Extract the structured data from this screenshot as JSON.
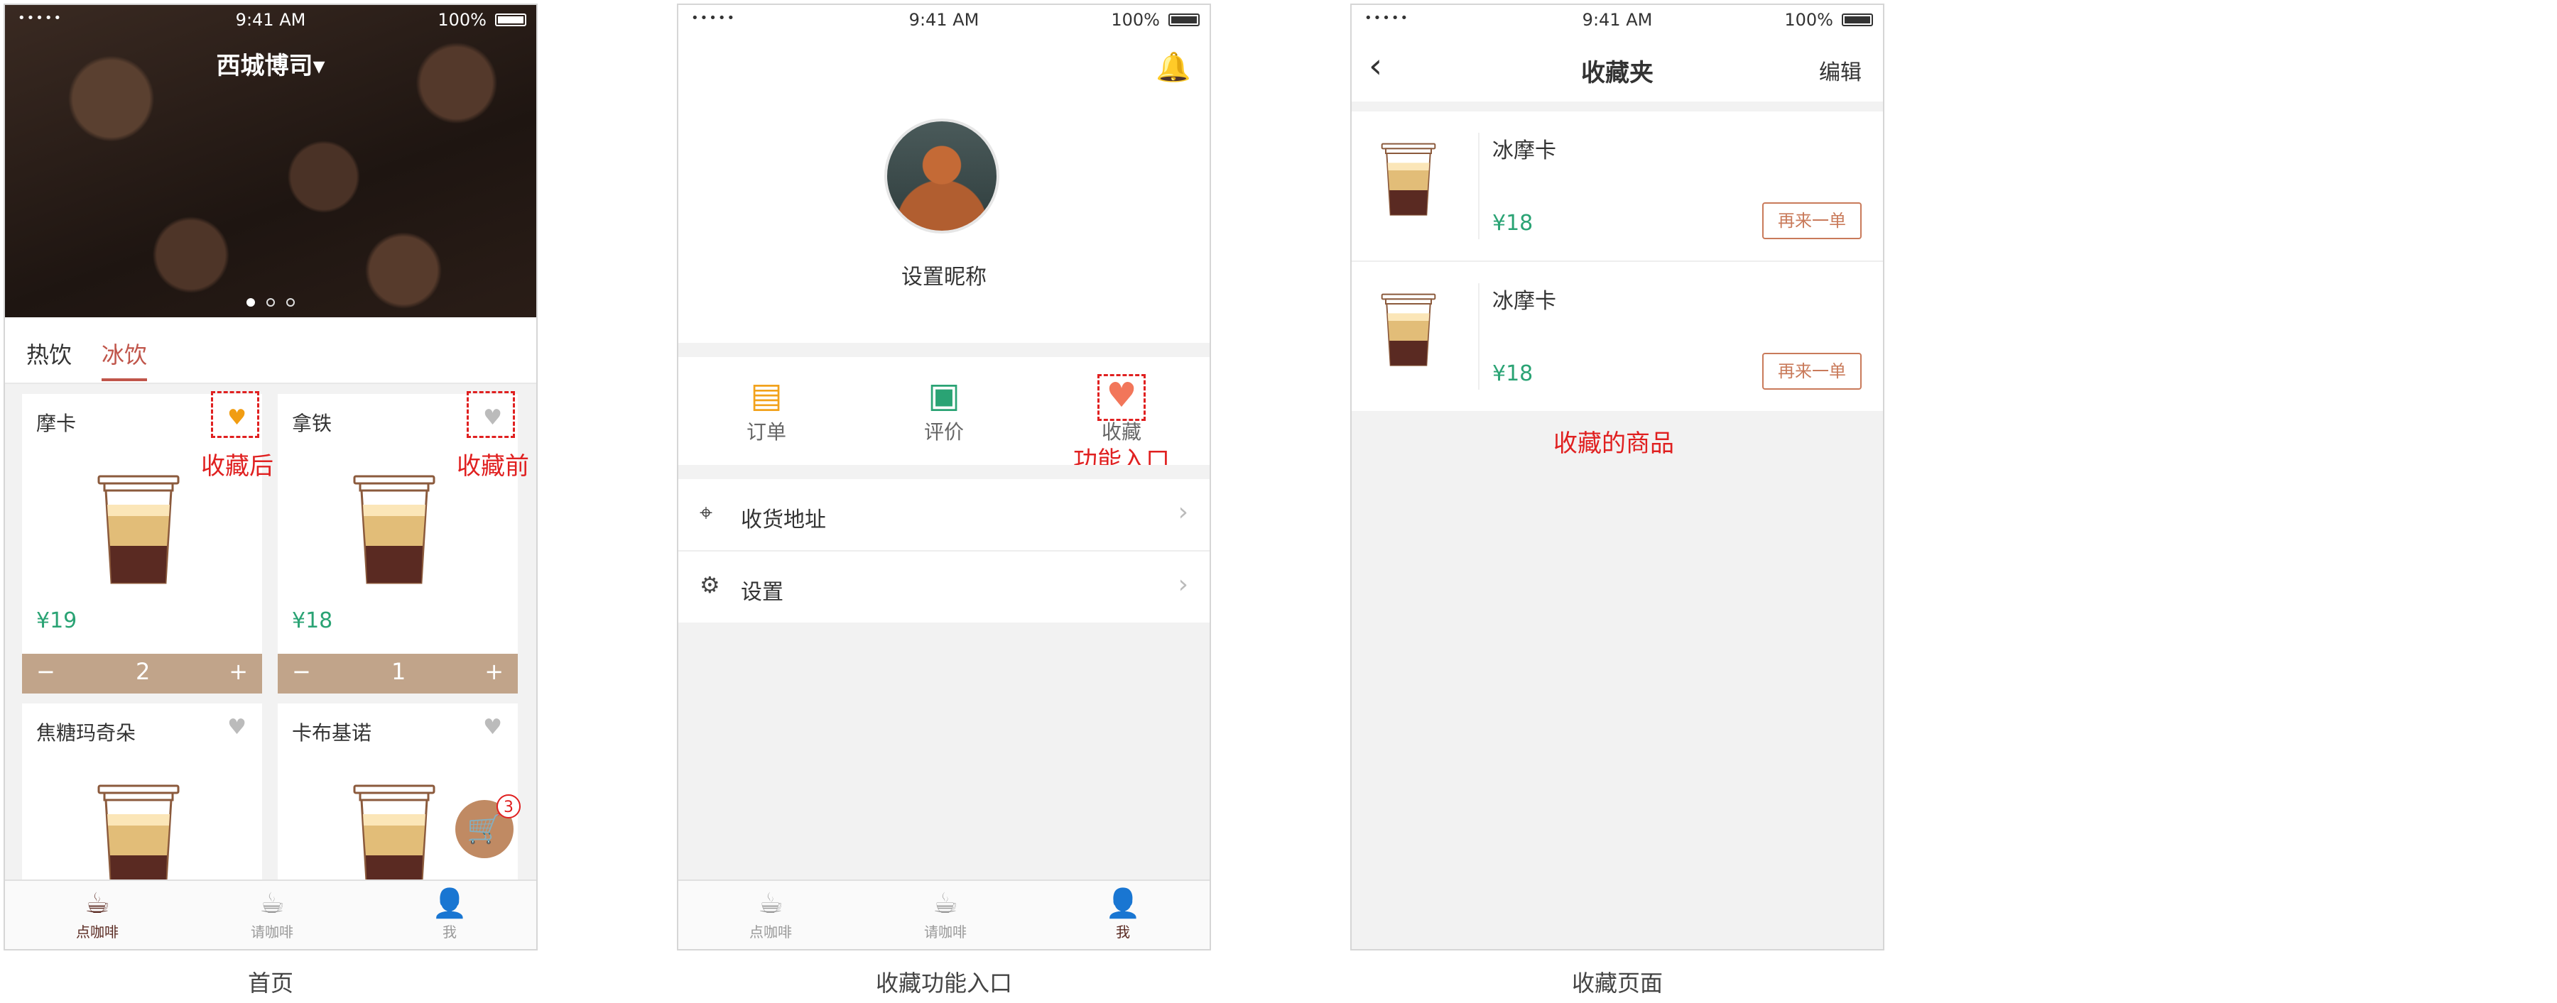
{
  "statusbar": {
    "time": "9:41 AM",
    "battery": "100%",
    "signal": "•••••"
  },
  "home": {
    "store_name": "西城博司▾",
    "tabs": [
      "热饮",
      "冰饮"
    ],
    "active_tab": "冰饮",
    "products": [
      {
        "name": "摩卡",
        "price": "¥19",
        "quantity": "2",
        "favorited": true
      },
      {
        "name": "拿铁",
        "price": "¥18",
        "quantity": "1",
        "favorited": false
      },
      {
        "name": "焦糖玛奇朵",
        "favorited": false
      },
      {
        "name": "卡布基诺",
        "favorited": false
      }
    ],
    "stepper_minus": "−",
    "stepper_plus": "+",
    "cart_count": "3",
    "annotation_after": "收藏后",
    "annotation_before": "收藏前"
  },
  "bottom_nav": [
    "点咖啡",
    "请咖啡",
    "我"
  ],
  "profile": {
    "nickname": "设置昵称",
    "functions": [
      "订单",
      "评价",
      "收藏"
    ],
    "annotation_entry": "功能入口",
    "rows": [
      "收货地址",
      "设置"
    ]
  },
  "favorites": {
    "title": "收藏夹",
    "edit": "编辑",
    "items": [
      {
        "name": "冰摩卡",
        "price": "¥18",
        "action": "再来一单"
      },
      {
        "name": "冰摩卡",
        "price": "¥18",
        "action": "再来一单"
      }
    ],
    "annotation": "收藏的商品"
  },
  "captions": [
    "首页",
    "收藏功能入口",
    "收藏页面"
  ],
  "colors": {
    "accent_red": "#c0554a",
    "price_green": "#2aa374",
    "stepper_brown": "#c1a48a",
    "annotation_red": "#e02020"
  }
}
